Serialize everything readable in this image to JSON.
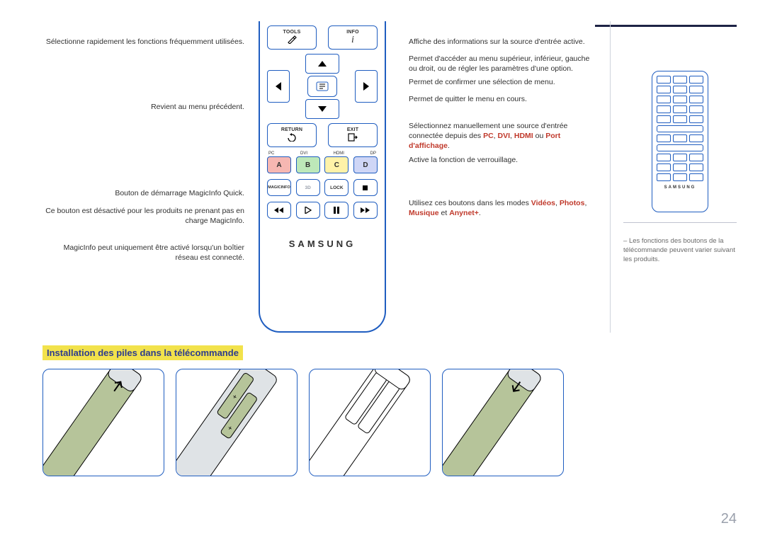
{
  "left": {
    "tools": "Sélectionne rapidement les fonctions fréquemment utilisées.",
    "return": "Revient au menu précédent.",
    "magicinfo1": "Bouton de démarrage MagicInfo Quick.",
    "magicinfo2": "Ce bouton est désactivé pour les produits ne prenant pas en charge MagicInfo.",
    "magicinfo3": "MagicInfo peut uniquement être activé lorsqu'un boîtier réseau est connecté."
  },
  "right": {
    "info": "Affiche des informations sur la source d'entrée active.",
    "dpad": "Permet d'accéder au menu supérieur, inférieur, gauche ou droit, ou de régler les paramètres d'une option.",
    "ok": "Permet de confirmer une sélection de menu.",
    "exit": "Permet de quitter le menu en cours.",
    "src_pre": "Sélectionnez manuellement une source d'entrée connectée depuis des ",
    "src_pc": "PC",
    "src_dvi": "DVI",
    "src_hdmi": "HDMI",
    "src_or": " ou ",
    "src_dp": "Port d'affichage",
    "lock": "Active la fonction de verrouillage.",
    "media_pre": "Utilisez ces boutons dans les modes ",
    "media_vid": "Vidéos",
    "media_sep1": ", ",
    "media_photos": "Photos",
    "media_sep2": ", ",
    "media_mus": "Musique",
    "media_et": " et ",
    "media_any": "Anynet+",
    "media_post": "."
  },
  "remote": {
    "tools": "TOOLS",
    "info": "INFO",
    "return": "RETURN",
    "exit": "EXIT",
    "srcs": [
      "PC",
      "DVI",
      "HDMI",
      "DP"
    ],
    "abcd": [
      "A",
      "B",
      "C",
      "D"
    ],
    "magic": "MAGICINFO",
    "threeD": "3D",
    "lock": "LOCK",
    "brand": "SAMSUNG"
  },
  "section_title": "Installation des piles dans la télécommande",
  "side": {
    "brand": "SAMSUNG",
    "note": "Les fonctions des boutons de la télécommande peuvent varier suivant les produits."
  },
  "page": "24"
}
